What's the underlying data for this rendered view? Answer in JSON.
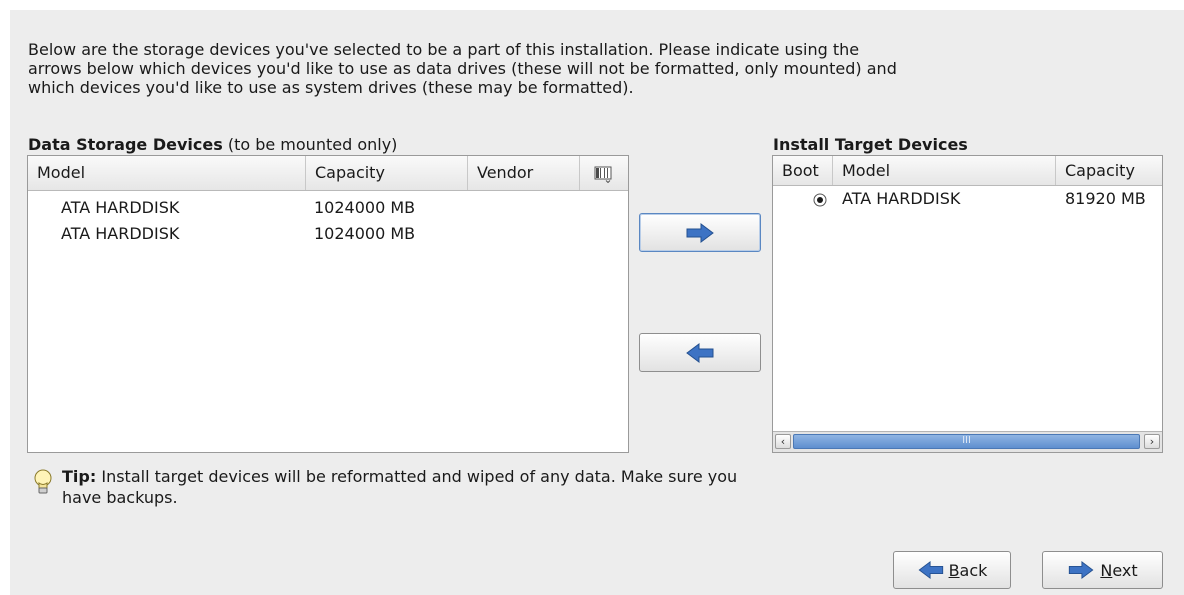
{
  "intro_text": "Below are the storage devices you've selected to be a part of this installation.  Please indicate using the arrows below which devices you'd like to use as data drives (these will not be formatted, only mounted) and which devices you'd like to use as system drives (these may be formatted).",
  "data_storage": {
    "title": "Data Storage Devices",
    "subtitle": "(to be mounted only)",
    "columns": [
      "Model",
      "Capacity",
      "Vendor"
    ],
    "column_chooser_icon": "columns-icon",
    "rows": [
      {
        "model": "ATA HARDDISK",
        "capacity": "1024000 MB",
        "vendor": ""
      },
      {
        "model": "ATA HARDDISK",
        "capacity": "1024000 MB",
        "vendor": ""
      }
    ]
  },
  "install_target": {
    "title": "Install Target Devices",
    "columns": [
      "Boot",
      "Model",
      "Capacity"
    ],
    "rows": [
      {
        "boot_selected": true,
        "model": "ATA HARDDISK",
        "capacity": "81920 MB"
      }
    ],
    "scrollbar_thumb_glyph": "III"
  },
  "move_right_icon": "arrow-right-icon",
  "move_left_icon": "arrow-left-icon",
  "tip": {
    "label": "Tip:",
    "text": "Install target devices will be reformatted and wiped of any data.  Make sure you",
    "text2": "have backups."
  },
  "nav": {
    "back_mnemonic": "B",
    "back_rest": "ack",
    "next_mnemonic": "N",
    "next_rest": "ext"
  },
  "colors": {
    "arrow_blue": "#3d73c4",
    "scroll_thumb": "#6f9bd6",
    "panel_bg": "#ededed"
  }
}
